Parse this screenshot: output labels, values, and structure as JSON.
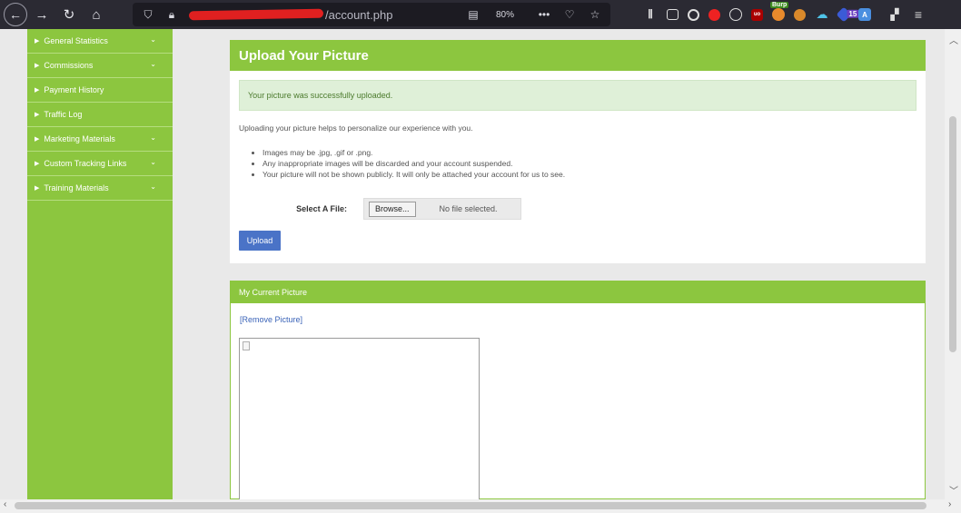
{
  "browser": {
    "url_path": "/account.php",
    "zoom": "80%",
    "extensions": {
      "badge_count": "15",
      "burp_label": "Burp"
    }
  },
  "sidebar": {
    "items": [
      {
        "label": "General Statistics",
        "has_chevron": true
      },
      {
        "label": "Commissions",
        "has_chevron": true
      },
      {
        "label": "Payment History",
        "has_chevron": false
      },
      {
        "label": "Traffic Log",
        "has_chevron": false
      },
      {
        "label": "Marketing Materials",
        "has_chevron": true
      },
      {
        "label": "Custom Tracking Links",
        "has_chevron": true
      },
      {
        "label": "Training Materials",
        "has_chevron": true
      }
    ]
  },
  "upload": {
    "title": "Upload Your Picture",
    "success_message": "Your picture was successfully uploaded.",
    "intro": "Uploading your picture helps to personalize our experience with you.",
    "rules": [
      "Images may be .jpg, .gif or .png.",
      "Any inappropriate images will be discarded and your account suspended.",
      "Your picture will not be shown publicly. It will only be attached your account for us to see."
    ],
    "file_label": "Select A File:",
    "browse_label": "Browse...",
    "no_file_text": "No file selected.",
    "upload_button": "Upload"
  },
  "current_picture": {
    "title": "My Current Picture",
    "remove_link": "[Remove Picture]"
  },
  "colors": {
    "accent_green": "#8cc63f",
    "upload_blue": "#4a73c7",
    "alert_bg": "#dff0d8"
  }
}
